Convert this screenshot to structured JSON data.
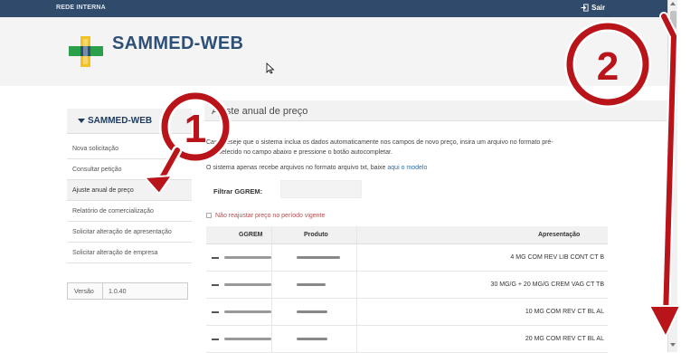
{
  "topbar": {
    "network": "REDE INTERNA",
    "logout": "Sair"
  },
  "header": {
    "brand": "SAMMED-WEB"
  },
  "sidebar": {
    "title": "SAMMED-WEB",
    "items": [
      {
        "label": "Nova solicitação",
        "active": false
      },
      {
        "label": "Consultar petição",
        "active": false
      },
      {
        "label": "Ajuste anual de preço",
        "active": true
      },
      {
        "label": "Relatório de comercialização",
        "active": false
      },
      {
        "label": "Solicitar alteração de apresentação",
        "active": false
      },
      {
        "label": "Solicitar alteração de empresa",
        "active": false
      }
    ],
    "version_label": "Versão",
    "version_value": "1.0.40"
  },
  "main": {
    "title": "Ajuste anual de preço",
    "para1": "Caso deseje que o sistema inclua os dados automaticamente nos campos de novo preço, insira um arquivo no formato pré-estabelecido no campo abaixo e pressione o botão autocompletar.",
    "para2_prefix": "O sistema apenas recebe arquivos no formato arquivo txt, baixe",
    "para2_link": "aqui o modelo",
    "filter_label": "Filtrar GGREM:",
    "filter_value": "",
    "checkbox_label": "Não reajustar preço no período vigente",
    "table": {
      "headers": [
        "GGREM",
        "Produto",
        "Apresentação"
      ],
      "rows": [
        {
          "apresentacao": "4 MG COM REV LIB CONT CT B"
        },
        {
          "apresentacao": "30 MG/G + 20 MG/G CREM VAG CT TB"
        },
        {
          "apresentacao": "10 MG COM REV CT BL AL"
        },
        {
          "apresentacao": "20 MG COM REV CT BL AL"
        }
      ]
    }
  },
  "annotations": [
    {
      "label": "1"
    },
    {
      "label": "2"
    }
  ],
  "colors": {
    "topbar": "#2f4a6b",
    "brand": "#2e4f76",
    "annotation": "#b8141a",
    "link": "#2e6da4"
  }
}
